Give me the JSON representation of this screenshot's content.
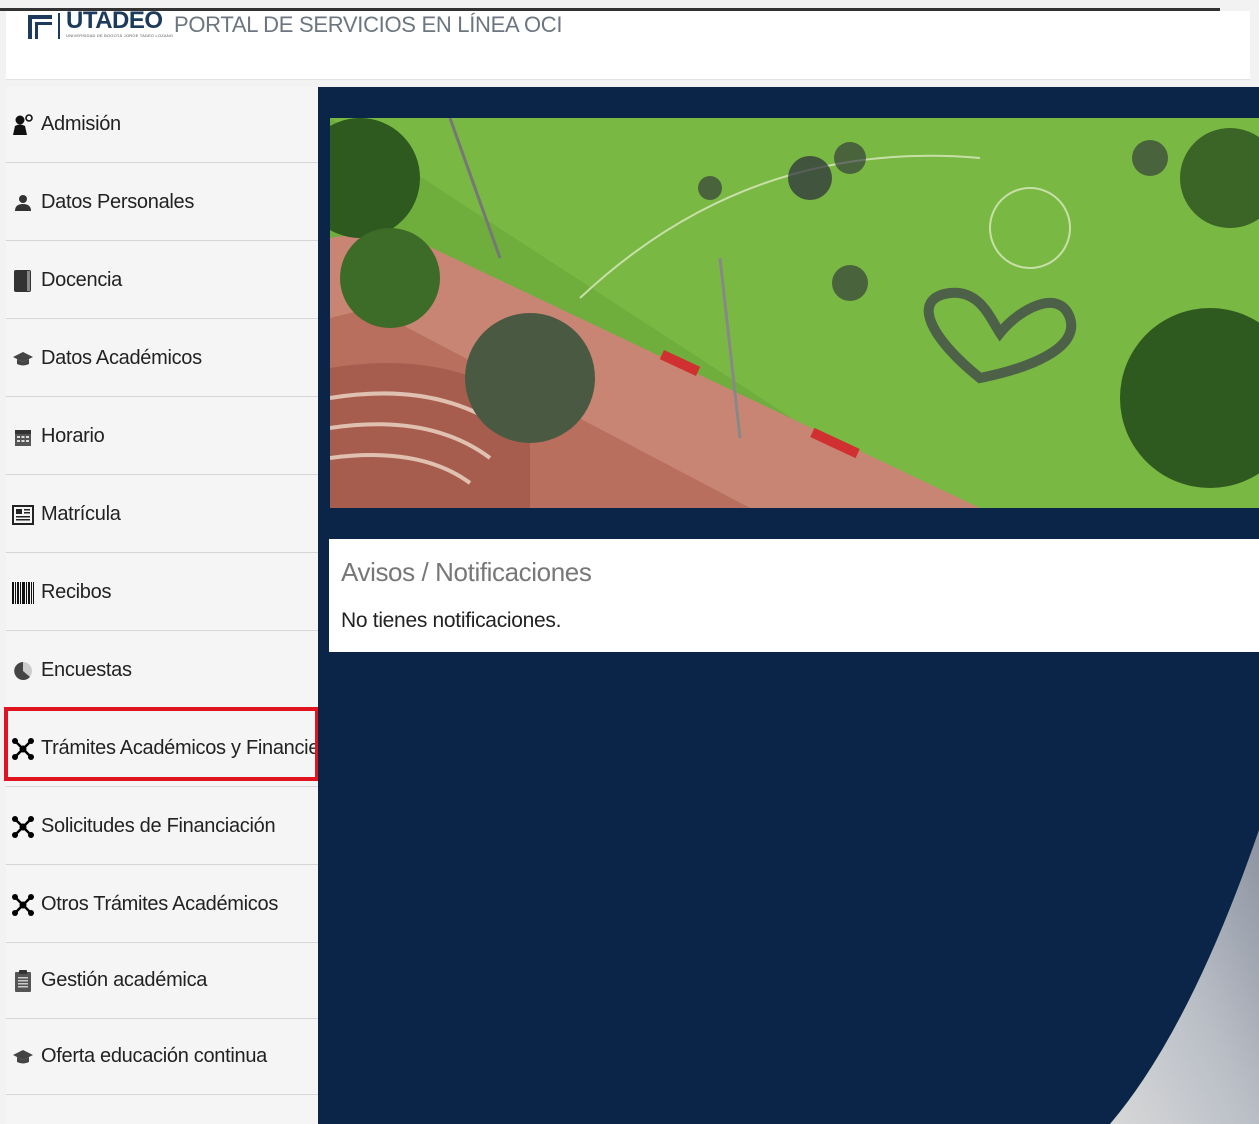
{
  "header": {
    "logo_text": "UTADEO",
    "logo_subtext": "UNIVERSIDAD DE BOGOTÁ JORGE TADEO LOZANO",
    "portal_title": "PORTAL DE SERVICIOS EN LÍNEA OCI"
  },
  "sidebar": {
    "items": [
      {
        "label": "Admisión",
        "icon": "admission-icon"
      },
      {
        "label": "Datos Personales",
        "icon": "user-icon"
      },
      {
        "label": "Docencia",
        "icon": "book-icon"
      },
      {
        "label": "Datos Académicos",
        "icon": "graduation-cap-icon"
      },
      {
        "label": "Horario",
        "icon": "calendar-icon"
      },
      {
        "label": "Matrícula",
        "icon": "newspaper-icon"
      },
      {
        "label": "Recibos",
        "icon": "barcode-icon"
      },
      {
        "label": "Encuestas",
        "icon": "pie-chart-icon"
      },
      {
        "label": "Trámites Académicos y Financie...",
        "icon": "network-icon"
      },
      {
        "label": "Solicitudes de Financiación",
        "icon": "network-icon"
      },
      {
        "label": "Otros Trámites Académicos",
        "icon": "network-icon"
      },
      {
        "label": "Gestión académica",
        "icon": "clipboard-icon"
      },
      {
        "label": "Oferta educación continua",
        "icon": "graduation-cap-icon"
      }
    ],
    "highlighted_index": 8
  },
  "main": {
    "banner_alt": "campus-aerial-photo",
    "notifications": {
      "title": "Avisos / Notificaciones",
      "message": "No tienes notificaciones."
    }
  },
  "colors": {
    "main_background": "#0a2547",
    "highlight_border": "#e0141e",
    "brand": "#1b3a5c"
  }
}
